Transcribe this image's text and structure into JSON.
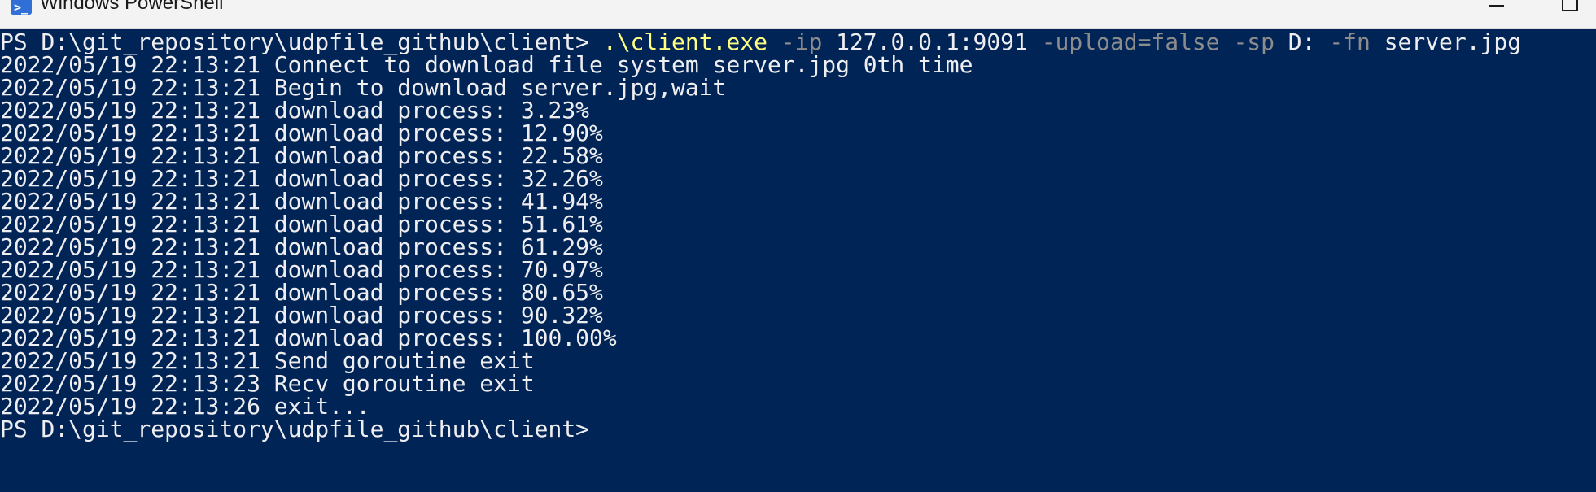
{
  "window": {
    "title": "Windows PowerShell",
    "app_icon": "powershell-icon",
    "icon_glyph": ">_",
    "controls": [
      "minimize-icon",
      "maximize-icon"
    ]
  },
  "colors": {
    "console_background": "#012456",
    "console_text": "#eeedf0",
    "command_name": "#ffff80",
    "command_parameter": "#8c8c8c"
  },
  "console": {
    "command": {
      "prompt": "PS D:\\git_repository\\udpfile_github\\client> ",
      "name": ".\\client.exe",
      "param_ip": "-ip",
      "val_ip": "127.0.0.1:9091",
      "param_upload": "-upload=false",
      "param_sp": "-sp",
      "val_sp": "D:",
      "param_fn": "-fn",
      "val_fn": "server.jpg"
    },
    "output": [
      "2022/05/19 22:13:21 Connect to download file system server.jpg 0th time",
      "2022/05/19 22:13:21 Begin to download server.jpg,wait",
      "2022/05/19 22:13:21 download process: 3.23%",
      "2022/05/19 22:13:21 download process: 12.90%",
      "2022/05/19 22:13:21 download process: 22.58%",
      "2022/05/19 22:13:21 download process: 32.26%",
      "2022/05/19 22:13:21 download process: 41.94%",
      "2022/05/19 22:13:21 download process: 51.61%",
      "2022/05/19 22:13:21 download process: 61.29%",
      "2022/05/19 22:13:21 download process: 70.97%",
      "2022/05/19 22:13:21 download process: 80.65%",
      "2022/05/19 22:13:21 download process: 90.32%",
      "2022/05/19 22:13:21 download process: 100.00%",
      "2022/05/19 22:13:21 Send goroutine exit",
      "2022/05/19 22:13:23 Recv goroutine exit",
      "2022/05/19 22:13:26 exit..."
    ],
    "final_prompt": "PS D:\\git_repository\\udpfile_github\\client>"
  }
}
